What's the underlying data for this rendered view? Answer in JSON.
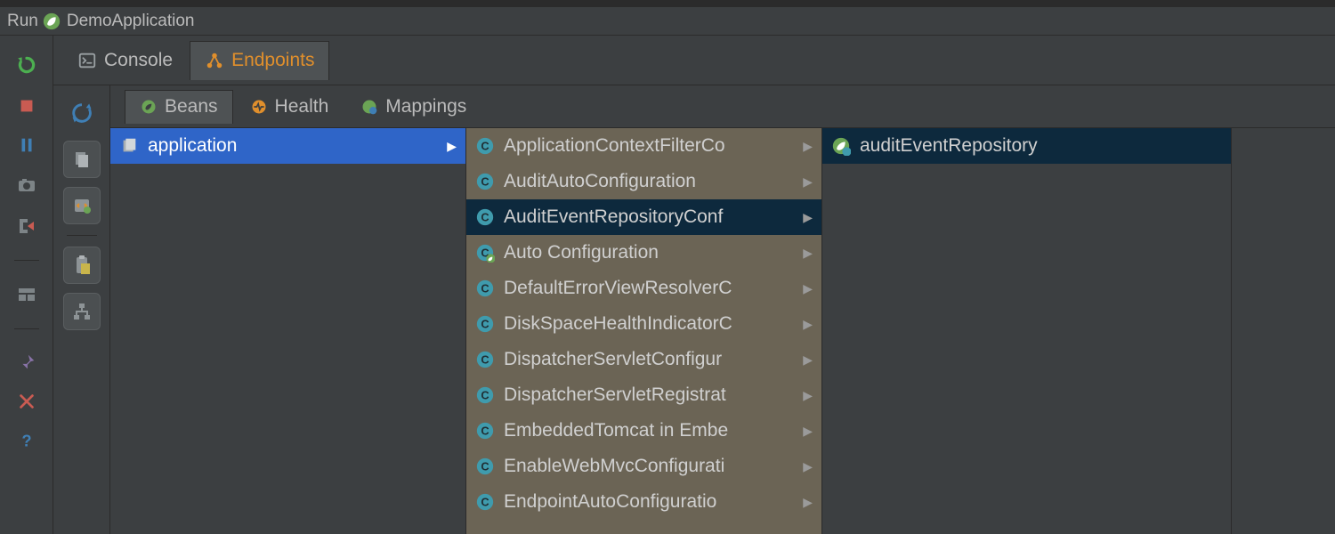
{
  "title": {
    "run": "Run",
    "app": "DemoApplication"
  },
  "tabs1": {
    "console": "Console",
    "endpoints": "Endpoints",
    "active": "endpoints"
  },
  "tabs2": {
    "beans": "Beans",
    "health": "Health",
    "mappings": "Mappings",
    "active": "beans"
  },
  "col1": {
    "items": [
      {
        "label": "application",
        "icon": "stack",
        "selected": true,
        "hasChildren": true
      }
    ]
  },
  "col2": {
    "items": [
      {
        "label": "ApplicationContextFilterCo",
        "icon": "class",
        "hasChildren": true
      },
      {
        "label": "AuditAutoConfiguration",
        "icon": "class",
        "hasChildren": true
      },
      {
        "label": "AuditEventRepositoryConf",
        "icon": "class",
        "selected": true,
        "hasChildren": true
      },
      {
        "label": "Auto Configuration",
        "icon": "spring-class",
        "hasChildren": true
      },
      {
        "label": "DefaultErrorViewResolverC",
        "icon": "class",
        "hasChildren": true
      },
      {
        "label": "DiskSpaceHealthIndicatorC",
        "icon": "class",
        "hasChildren": true
      },
      {
        "label": "DispatcherServletConfigur",
        "icon": "class",
        "hasChildren": true
      },
      {
        "label": "DispatcherServletRegistrat",
        "icon": "class",
        "hasChildren": true
      },
      {
        "label": "EmbeddedTomcat in Embe",
        "icon": "class",
        "hasChildren": true
      },
      {
        "label": "EnableWebMvcConfigurati",
        "icon": "class",
        "hasChildren": true
      },
      {
        "label": "EndpointAutoConfiguratio",
        "icon": "class",
        "hasChildren": true
      }
    ]
  },
  "col3": {
    "items": [
      {
        "label": "auditEventRepository",
        "icon": "spring-bean",
        "selected": true,
        "hasChildren": false
      }
    ]
  },
  "colors": {
    "green": "#6ba455",
    "orange": "#e08f2c",
    "teal": "#3f9bad",
    "classBlue": "#3f9bad",
    "beanGreen": "#6ba455",
    "red": "#c95b52",
    "pause": "#3f7fb5",
    "yellow": "#c9b54b",
    "blueSel": "#2f65c8",
    "darkSel": "#0d293d"
  }
}
